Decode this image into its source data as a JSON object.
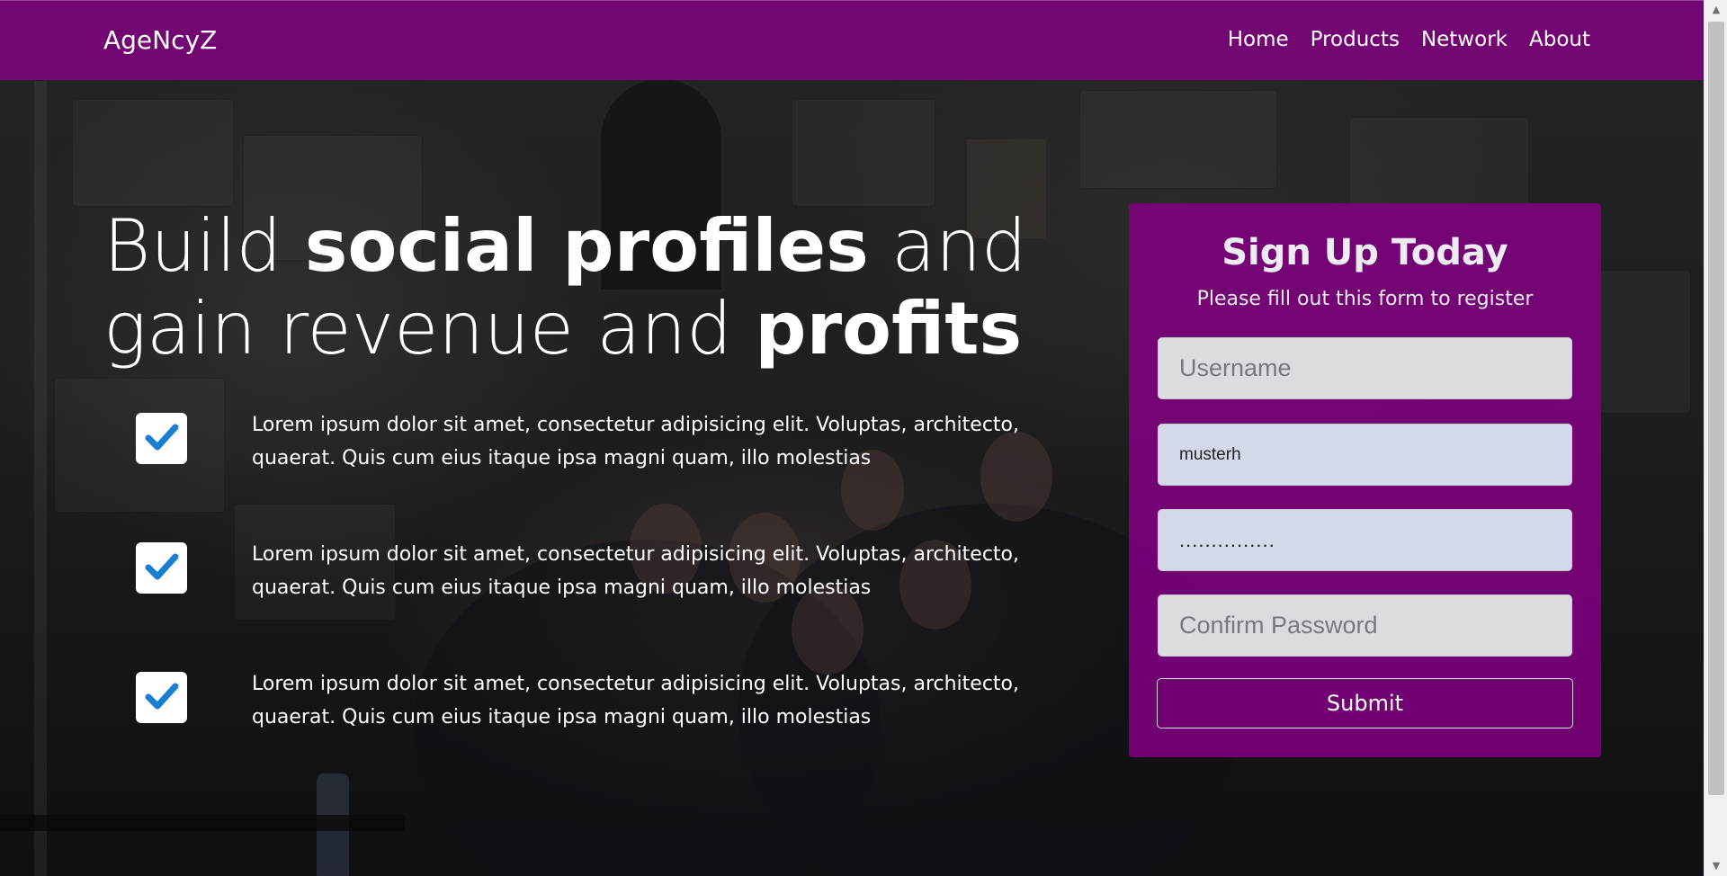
{
  "nav": {
    "brand": "AgeNcyZ",
    "links": [
      "Home",
      "Products",
      "Network",
      "About"
    ]
  },
  "hero": {
    "heading": {
      "part1": "Build ",
      "part2": "social profiles",
      "part3": " and gain revenue and ",
      "part4": "profits"
    },
    "features": [
      "Lorem ipsum dolor sit amet, consectetur adipisicing elit. Voluptas, architecto, quaerat. Quis cum eius itaque ipsa magni quam, illo molestias",
      "Lorem ipsum dolor sit amet, consectetur adipisicing elit. Voluptas, architecto, quaerat. Quis cum eius itaque ipsa magni quam, illo molestias",
      "Lorem ipsum dolor sit amet, consectetur adipisicing elit. Voluptas, architecto, quaerat. Quis cum eius itaque ipsa magni quam, illo molestias"
    ]
  },
  "signup": {
    "title": "Sign Up Today",
    "subtitle": "Please fill out this form to register",
    "username_placeholder": "Username",
    "email_value": "musterh",
    "password_value": "...............",
    "confirm_placeholder": "Confirm Password",
    "submit_label": "Submit"
  },
  "icons": {
    "feature_check": "check-icon",
    "scroll_up": "arrow-up-icon",
    "scroll_down": "arrow-down-icon"
  },
  "colors": {
    "brand_purple": "#800080",
    "check_blue": "#1a7fd0"
  }
}
